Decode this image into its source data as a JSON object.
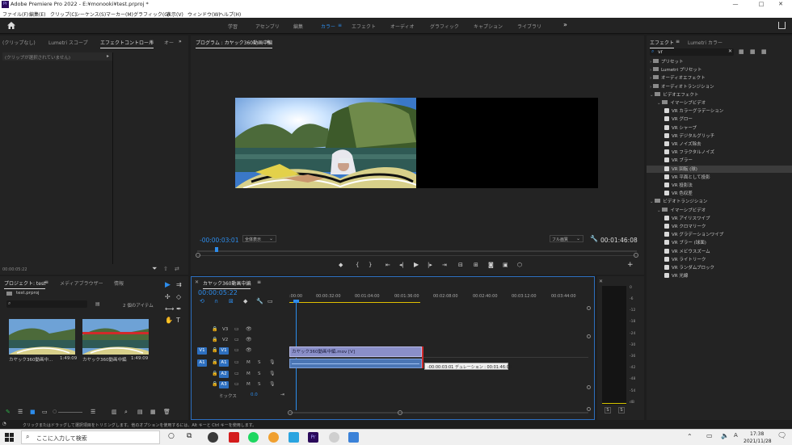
{
  "app": {
    "title": "Adobe Premiere Pro 2022 - E:¥monooki¥test.prproj *",
    "logo": "Pr",
    "window_controls": [
      "—",
      "□",
      "✕"
    ]
  },
  "menu": [
    "ファイル(F)",
    "編集(E)",
    "クリップ(C)",
    "シーケンス(S)",
    "マーカー(M)",
    "グラフィック(G)",
    "表示(V)",
    "ウィンドウ(W)",
    "ヘルプ(H)"
  ],
  "workspaces": {
    "items": [
      "学習",
      "アセンブリ",
      "編集",
      "カラー",
      "エフェクト",
      "オーディオ",
      "グラフィック",
      "キャプション",
      "ライブラリ"
    ],
    "active": "カラー",
    "more": "»"
  },
  "effect_controls": {
    "tabs": [
      "(クリップなし)",
      "Lumetri スコープ",
      "エフェクトコントロール",
      "オー"
    ],
    "active_tab": "エフェクトコントロール",
    "empty_message": "(クリップが選択されていません)",
    "timecode": "00:00:05:22"
  },
  "program_monitor": {
    "tab": "プログラム : カヤック360動画中編",
    "timecode_current": "-00:00:03:01",
    "fit": "全体表示",
    "quality": "フル画質",
    "timecode_duration": "00:01:46:08"
  },
  "project": {
    "tabs": [
      "プロジェクト: test",
      "メディアブラウザー",
      "情報"
    ],
    "file": "test.prproj",
    "item_count": "2 個のアイテム",
    "items": [
      {
        "name": "カヤック360動画中...",
        "duration": "1:49:09"
      },
      {
        "name": "カヤック360動画中編",
        "duration": "1:49:09"
      }
    ]
  },
  "timeline": {
    "tab": "カヤック360動画中編",
    "timecode": "00:00:05:22",
    "ruler": [
      ":00:00",
      "00:00:32:00",
      "00:01:04:00",
      "00:01:36:00",
      "00:02:08:00",
      "00:02:40:00",
      "00:03:12:00",
      "00:03:44:00"
    ],
    "video_tracks": [
      "V3",
      "V2",
      "V1"
    ],
    "audio_tracks": [
      "A1",
      "A2",
      "A3"
    ],
    "src_v": "V1",
    "src_a": "A1",
    "mix_label": "ミックス",
    "mix_value": "0.0",
    "clip_label": "カヤック360動画中編.mov [V]",
    "tooltip": "-00:00:03:01 デュレーション : 00:01:46:08"
  },
  "audio_meter": {
    "scale": [
      "0",
      "-6",
      "-12",
      "-18",
      "-24",
      "-30",
      "-36",
      "-42",
      "-48",
      "-54",
      "dB"
    ],
    "solo": [
      "S",
      "S"
    ]
  },
  "effects": {
    "tabs": [
      "エフェクト",
      "Lumetri カラー"
    ],
    "active_tab": "エフェクト",
    "search_value": "vr",
    "rows": [
      {
        "level": 0,
        "type": "folder",
        "label": "プリセット",
        "open": false
      },
      {
        "level": 0,
        "type": "folder",
        "label": "Lumetri プリセット",
        "open": false
      },
      {
        "level": 0,
        "type": "folder",
        "label": "オーディオエフェクト",
        "open": false
      },
      {
        "level": 0,
        "type": "folder",
        "label": "オーディオトランジション",
        "open": false
      },
      {
        "level": 0,
        "type": "folder",
        "label": "ビデオエフェクト",
        "open": true
      },
      {
        "level": 1,
        "type": "folder",
        "label": "イマーシブビデオ",
        "open": true
      },
      {
        "level": 2,
        "type": "fx",
        "label": "VR カラーグラデーション"
      },
      {
        "level": 2,
        "type": "fx",
        "label": "VR グロー"
      },
      {
        "level": 2,
        "type": "fx",
        "label": "VR シャープ"
      },
      {
        "level": 2,
        "type": "fx",
        "label": "VR デジタルグリッチ"
      },
      {
        "level": 2,
        "type": "fx",
        "label": "VR ノイズ除去"
      },
      {
        "level": 2,
        "type": "fx",
        "label": "VR フラクタルノイズ"
      },
      {
        "level": 2,
        "type": "fx",
        "label": "VR ブラー"
      },
      {
        "level": 2,
        "type": "fx",
        "label": "VR 回転 (球)",
        "selected": true
      },
      {
        "level": 2,
        "type": "fx",
        "label": "VR 平面として投影"
      },
      {
        "level": 2,
        "type": "fx",
        "label": "VR 投影法"
      },
      {
        "level": 2,
        "type": "fx",
        "label": "VR 色収差"
      },
      {
        "level": 0,
        "type": "folder",
        "label": "ビデオトランジション",
        "open": true
      },
      {
        "level": 1,
        "type": "folder",
        "label": "イマーシブビデオ",
        "open": true
      },
      {
        "level": 2,
        "type": "fx",
        "label": "VR アイリスワイプ"
      },
      {
        "level": 2,
        "type": "fx",
        "label": "VR クロマリーク"
      },
      {
        "level": 2,
        "type": "fx",
        "label": "VR グラデーションワイプ"
      },
      {
        "level": 2,
        "type": "fx",
        "label": "VR ブラー (球面)"
      },
      {
        "level": 2,
        "type": "fx",
        "label": "VR メビウスズーム"
      },
      {
        "level": 2,
        "type": "fx",
        "label": "VR ライトリーク"
      },
      {
        "level": 2,
        "type": "fx",
        "label": "VR ランダムブロック"
      },
      {
        "level": 2,
        "type": "fx",
        "label": "VR 光線"
      }
    ]
  },
  "status_bar": "クリックまたはドラッグして選択項目をトリミングします。他のオプションを使用するには、Alt キーと Ctrl キーを使用します。",
  "taskbar": {
    "search_placeholder": "ここに入力して検索",
    "time": "17:38",
    "date": "2021/11/28"
  }
}
